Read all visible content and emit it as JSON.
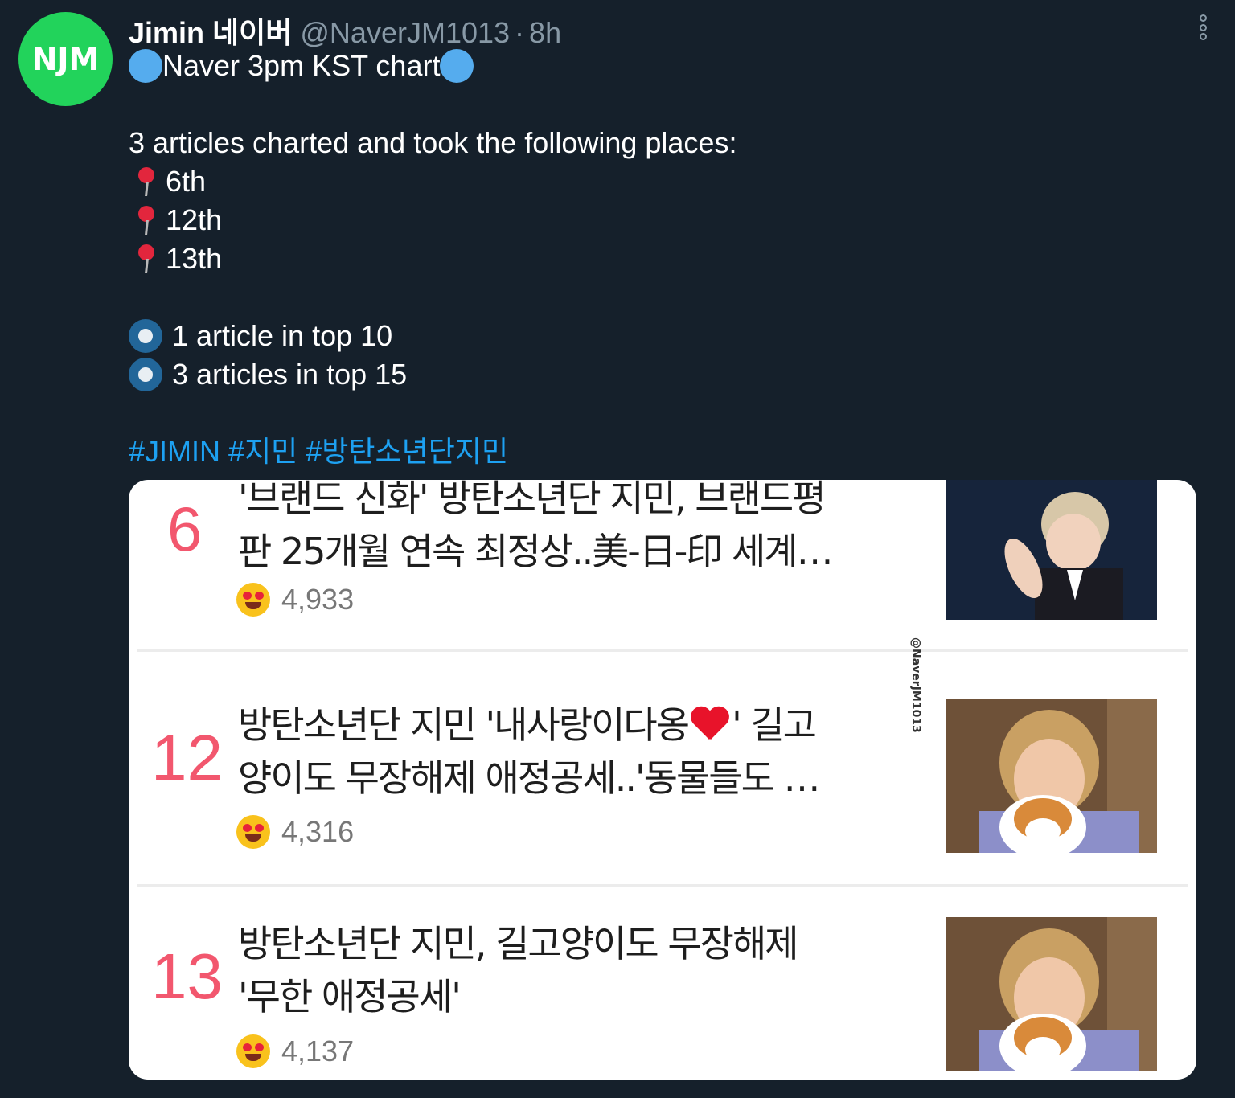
{
  "tweet": {
    "avatar_text": "NJM",
    "display_name": "Jimin 네이버",
    "handle": "@NaverJM1013",
    "separator": "·",
    "time": "8h",
    "title": "Naver 3pm KST chart",
    "intro": "3 articles charted and took the following places:",
    "places": [
      "6th",
      "12th",
      "13th"
    ],
    "summary": [
      "1 article in top 10",
      "3 articles in top 15"
    ],
    "hashtags": [
      "#JIMIN",
      "#지민",
      "#방탄소년단지민"
    ]
  },
  "media": {
    "watermark": "@NaverJM1013",
    "articles": [
      {
        "rank": "6",
        "line1": "'브랜드 신화' 방탄소년단 지민, 브랜드평",
        "line2": "판 25개월 연속 최정상..美-日-印 세계…",
        "count": "4,933"
      },
      {
        "rank": "12",
        "line1a": "방탄소년단 지민 '내사랑이다옹",
        "line1b": "' 길고",
        "line2": "양이도 무장해제 애정공세..'동물들도 …",
        "count": "4,316"
      },
      {
        "rank": "13",
        "line1": "방탄소년단 지민, 길고양이도 무장해제",
        "line2": "'무한 애정공세'",
        "count": "4,137"
      }
    ]
  },
  "icons": {
    "avatar": "njm-logo",
    "more": "vertical-dots-icon",
    "title_marker": "blue-circle-emoji",
    "place_marker": "round-pushpin-emoji",
    "summary_marker": "radio-button-emoji",
    "reaction": "heart-eyes-emoji"
  },
  "colors": {
    "background": "#15202b",
    "avatar": "#22d35b",
    "hashtag": "#1da1f2",
    "rank": "#f2576e",
    "muted": "#8899a6"
  }
}
